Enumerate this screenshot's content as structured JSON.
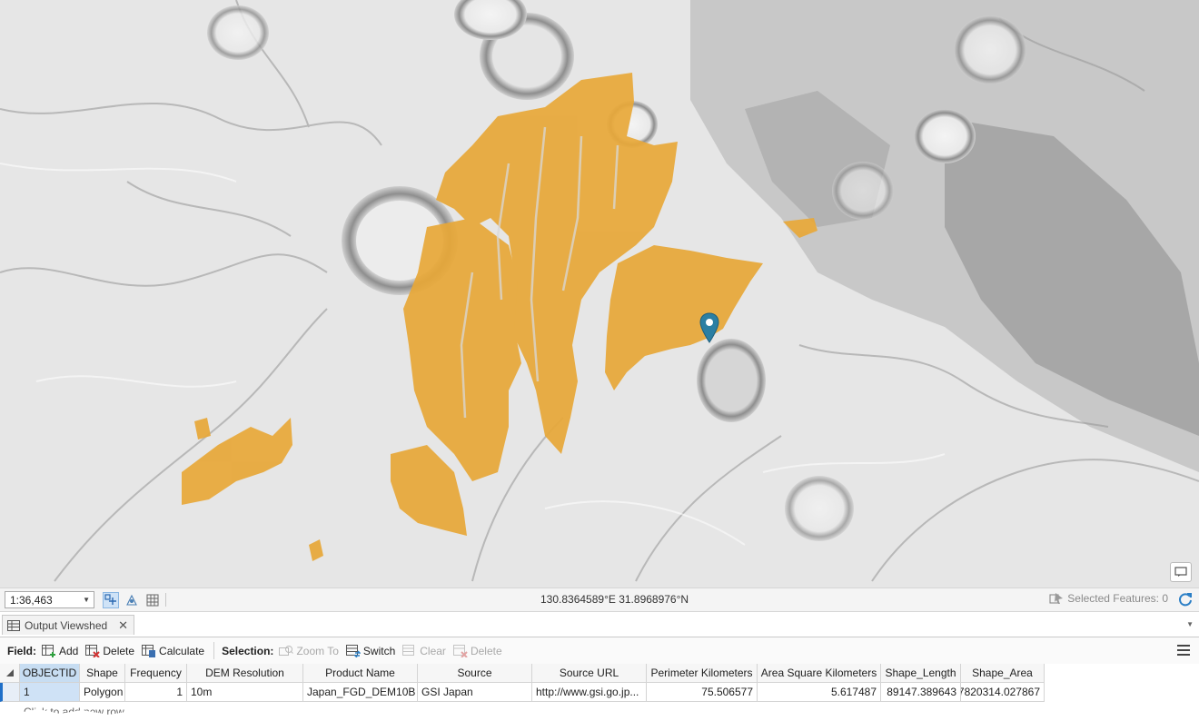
{
  "statusbar": {
    "scale": "1:36,463",
    "coordinates": "130.8364589°E 31.8968976°N",
    "selected_features": "Selected Features: 0"
  },
  "table_pane": {
    "tab_title": "Output Viewshed",
    "toolbar": {
      "field_label": "Field:",
      "add": "Add",
      "delete": "Delete",
      "calculate": "Calculate",
      "selection_label": "Selection:",
      "zoom_to": "Zoom To",
      "switch": "Switch",
      "clear": "Clear",
      "sel_delete": "Delete"
    },
    "columns": [
      "OBJECTID",
      "Shape",
      "Frequency",
      "DEM Resolution",
      "Product Name",
      "Source",
      "Source URL",
      "Perimeter Kilometers",
      "Area Square Kilometers",
      "Shape_Length",
      "Shape_Area"
    ],
    "rows": [
      [
        "1",
        "Polygon",
        "1",
        "10m",
        "Japan_FGD_DEM10B",
        "GSI Japan",
        "http://www.gsi.go.jp...",
        "75.506577",
        "5.617487",
        "89147.389643",
        "7820314.027867"
      ]
    ],
    "add_row_hint": "Click to add new row."
  },
  "colors": {
    "viewshed": "#e8a838",
    "pin": "#2b7fa3",
    "selection_accent": "#1f6fc8"
  },
  "icons": [
    "location-pin-icon",
    "map-options-icon",
    "navigator-icon",
    "snapping-icon",
    "grid-icon",
    "selected-features-icon",
    "refresh-icon",
    "table-icon",
    "add-field-icon",
    "delete-field-icon",
    "calculate-field-icon",
    "zoom-to-icon",
    "switch-selection-icon",
    "clear-selection-icon",
    "delete-selection-icon",
    "hamburger-menu-icon"
  ]
}
